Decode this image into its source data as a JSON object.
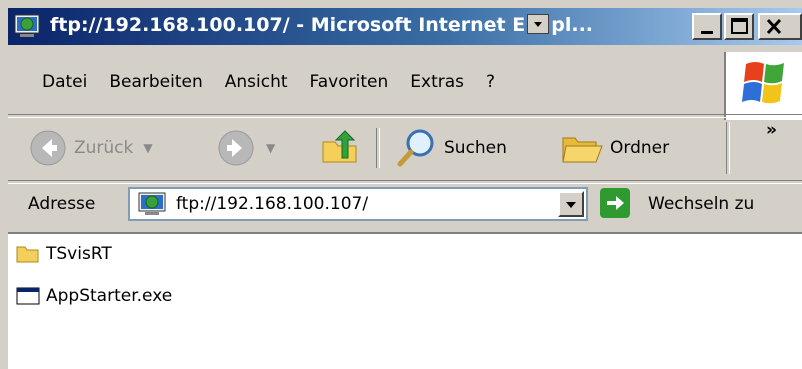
{
  "window": {
    "title": "ftp://192.168.100.107/ - Microsoft Internet E",
    "title_trail": "pl..."
  },
  "menu": {
    "items": [
      "Datei",
      "Bearbeiten",
      "Ansicht",
      "Favoriten",
      "Extras",
      "?"
    ]
  },
  "toolbar": {
    "back_label": "Zurück",
    "search_label": "Suchen",
    "folders_label": "Ordner",
    "overflow": "»"
  },
  "address": {
    "label": "Adresse",
    "value": "ftp://192.168.100.107/",
    "go_label": "Wechseln zu"
  },
  "files": [
    {
      "name": "TSvisRT",
      "icon": "folder-icon"
    },
    {
      "name": "AppStarter.exe",
      "icon": "application-icon"
    }
  ],
  "colors": {
    "title_start": "#0a246a",
    "title_end": "#a6caf0",
    "face": "#d4d0c8"
  }
}
